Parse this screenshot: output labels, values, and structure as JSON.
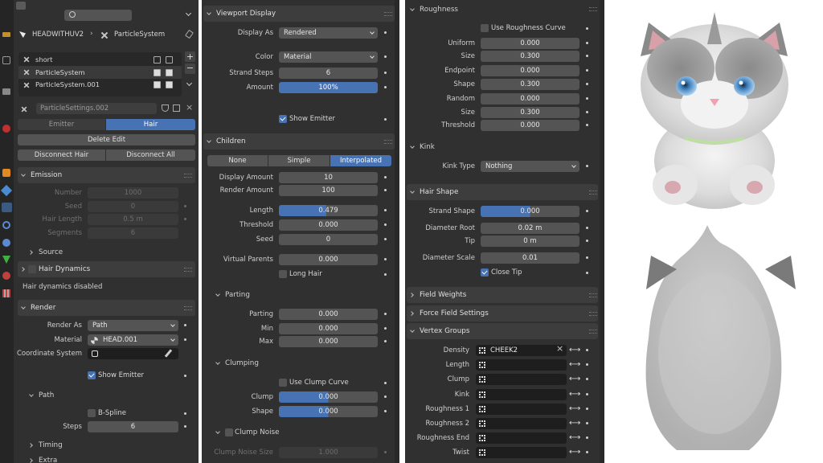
{
  "left": {
    "header_object": "HEADWITHUV2",
    "header_system": "ParticleSystem",
    "list": [
      "short",
      "ParticleSystem",
      "ParticleSystem.001"
    ],
    "settings_name": "ParticleSettings.002",
    "type_tabs": [
      "Emitter",
      "Hair"
    ],
    "delete_edit": "Delete Edit",
    "disconnect_hair": "Disconnect Hair",
    "disconnect_all": "Disconnect All",
    "emission": {
      "title": "Emission",
      "rows": [
        {
          "label": "Number",
          "value": "1000"
        },
        {
          "label": "Seed",
          "value": "0"
        },
        {
          "label": "Hair Length",
          "value": "0.5 m"
        },
        {
          "label": "Segments",
          "value": "6"
        }
      ],
      "source": "Source"
    },
    "hair_dynamics": "Hair Dynamics",
    "hair_dynamics_note": "Hair dynamics disabled",
    "render": {
      "title": "Render",
      "render_as_label": "Render As",
      "render_as_value": "Path",
      "material_label": "Material",
      "material_value": "HEAD.001",
      "coord_label": "Coordinate System",
      "show_emitter": "Show Emitter",
      "path": "Path",
      "bspline": "B-Spline",
      "steps_label": "Steps",
      "steps_value": "6",
      "timing": "Timing",
      "extra": "Extra"
    }
  },
  "middle": {
    "viewport_display": "Viewport Display",
    "display_as_label": "Display As",
    "display_as_value": "Rendered",
    "color_label": "Color",
    "color_value": "Material",
    "strand_steps_label": "Strand Steps",
    "strand_steps_value": "6",
    "amount_label": "Amount",
    "amount_value": "100%",
    "show_emitter": "Show Emitter",
    "children": "Children",
    "children_tabs": [
      "None",
      "Simple",
      "Interpolated"
    ],
    "display_amount_label": "Display Amount",
    "display_amount_value": "10",
    "render_amount_label": "Render Amount",
    "render_amount_value": "100",
    "length_label": "Length",
    "length_value": "0.479",
    "threshold_label": "Threshold",
    "threshold_value": "0.000",
    "seed_label": "Seed",
    "seed_value": "0",
    "virtual_parents_label": "Virtual Parents",
    "virtual_parents_value": "0.000",
    "long_hair": "Long Hair",
    "parting": "Parting",
    "parting_rows": [
      {
        "label": "Parting",
        "value": "0.000"
      },
      {
        "label": "Min",
        "value": "0.000"
      },
      {
        "label": "Max",
        "value": "0.000"
      }
    ],
    "clumping": "Clumping",
    "use_clump_curve": "Use Clump Curve",
    "clump_label": "Clump",
    "clump_value": "0.000",
    "shape_label": "Shape",
    "shape_value": "0.000",
    "clump_noise": "Clump Noise",
    "clump_noise_size_label": "Clump Noise Size",
    "clump_noise_size_value": "1.000"
  },
  "right": {
    "roughness": "Roughness",
    "use_roughness_curve": "Use Roughness Curve",
    "rough_rows": [
      {
        "label": "Uniform",
        "value": "0.000"
      },
      {
        "label": "Size",
        "value": "0.300"
      },
      {
        "label": "Endpoint",
        "value": "0.000"
      },
      {
        "label": "Shape",
        "value": "0.300"
      },
      {
        "label": "Random",
        "value": "0.000"
      },
      {
        "label": "Size",
        "value": "0.300"
      },
      {
        "label": "Threshold",
        "value": "0.000"
      }
    ],
    "kink": "Kink",
    "kink_type_label": "Kink Type",
    "kink_type_value": "Nothing",
    "hair_shape": "Hair Shape",
    "strand_shape_label": "Strand Shape",
    "strand_shape_value": "0.000",
    "diameter_root_label": "Diameter Root",
    "diameter_root_value": "0.02 m",
    "tip_label": "Tip",
    "tip_value": "0 m",
    "diameter_scale_label": "Diameter Scale",
    "diameter_scale_value": "0.01",
    "close_tip": "Close Tip",
    "field_weights": "Field Weights",
    "force_field": "Force Field Settings",
    "vertex_groups": "Vertex Groups",
    "vg_rows": [
      {
        "label": "Density",
        "value": "CHEEK2"
      },
      {
        "label": "Length",
        "value": ""
      },
      {
        "label": "Clump",
        "value": ""
      },
      {
        "label": "Kink",
        "value": ""
      },
      {
        "label": "Roughness 1",
        "value": ""
      },
      {
        "label": "Roughness 2",
        "value": ""
      },
      {
        "label": "Roughness End",
        "value": ""
      },
      {
        "label": "Twist",
        "value": ""
      }
    ]
  },
  "colors": {
    "accent": "#4772b3",
    "panel": "#303030",
    "field": "#545454"
  }
}
